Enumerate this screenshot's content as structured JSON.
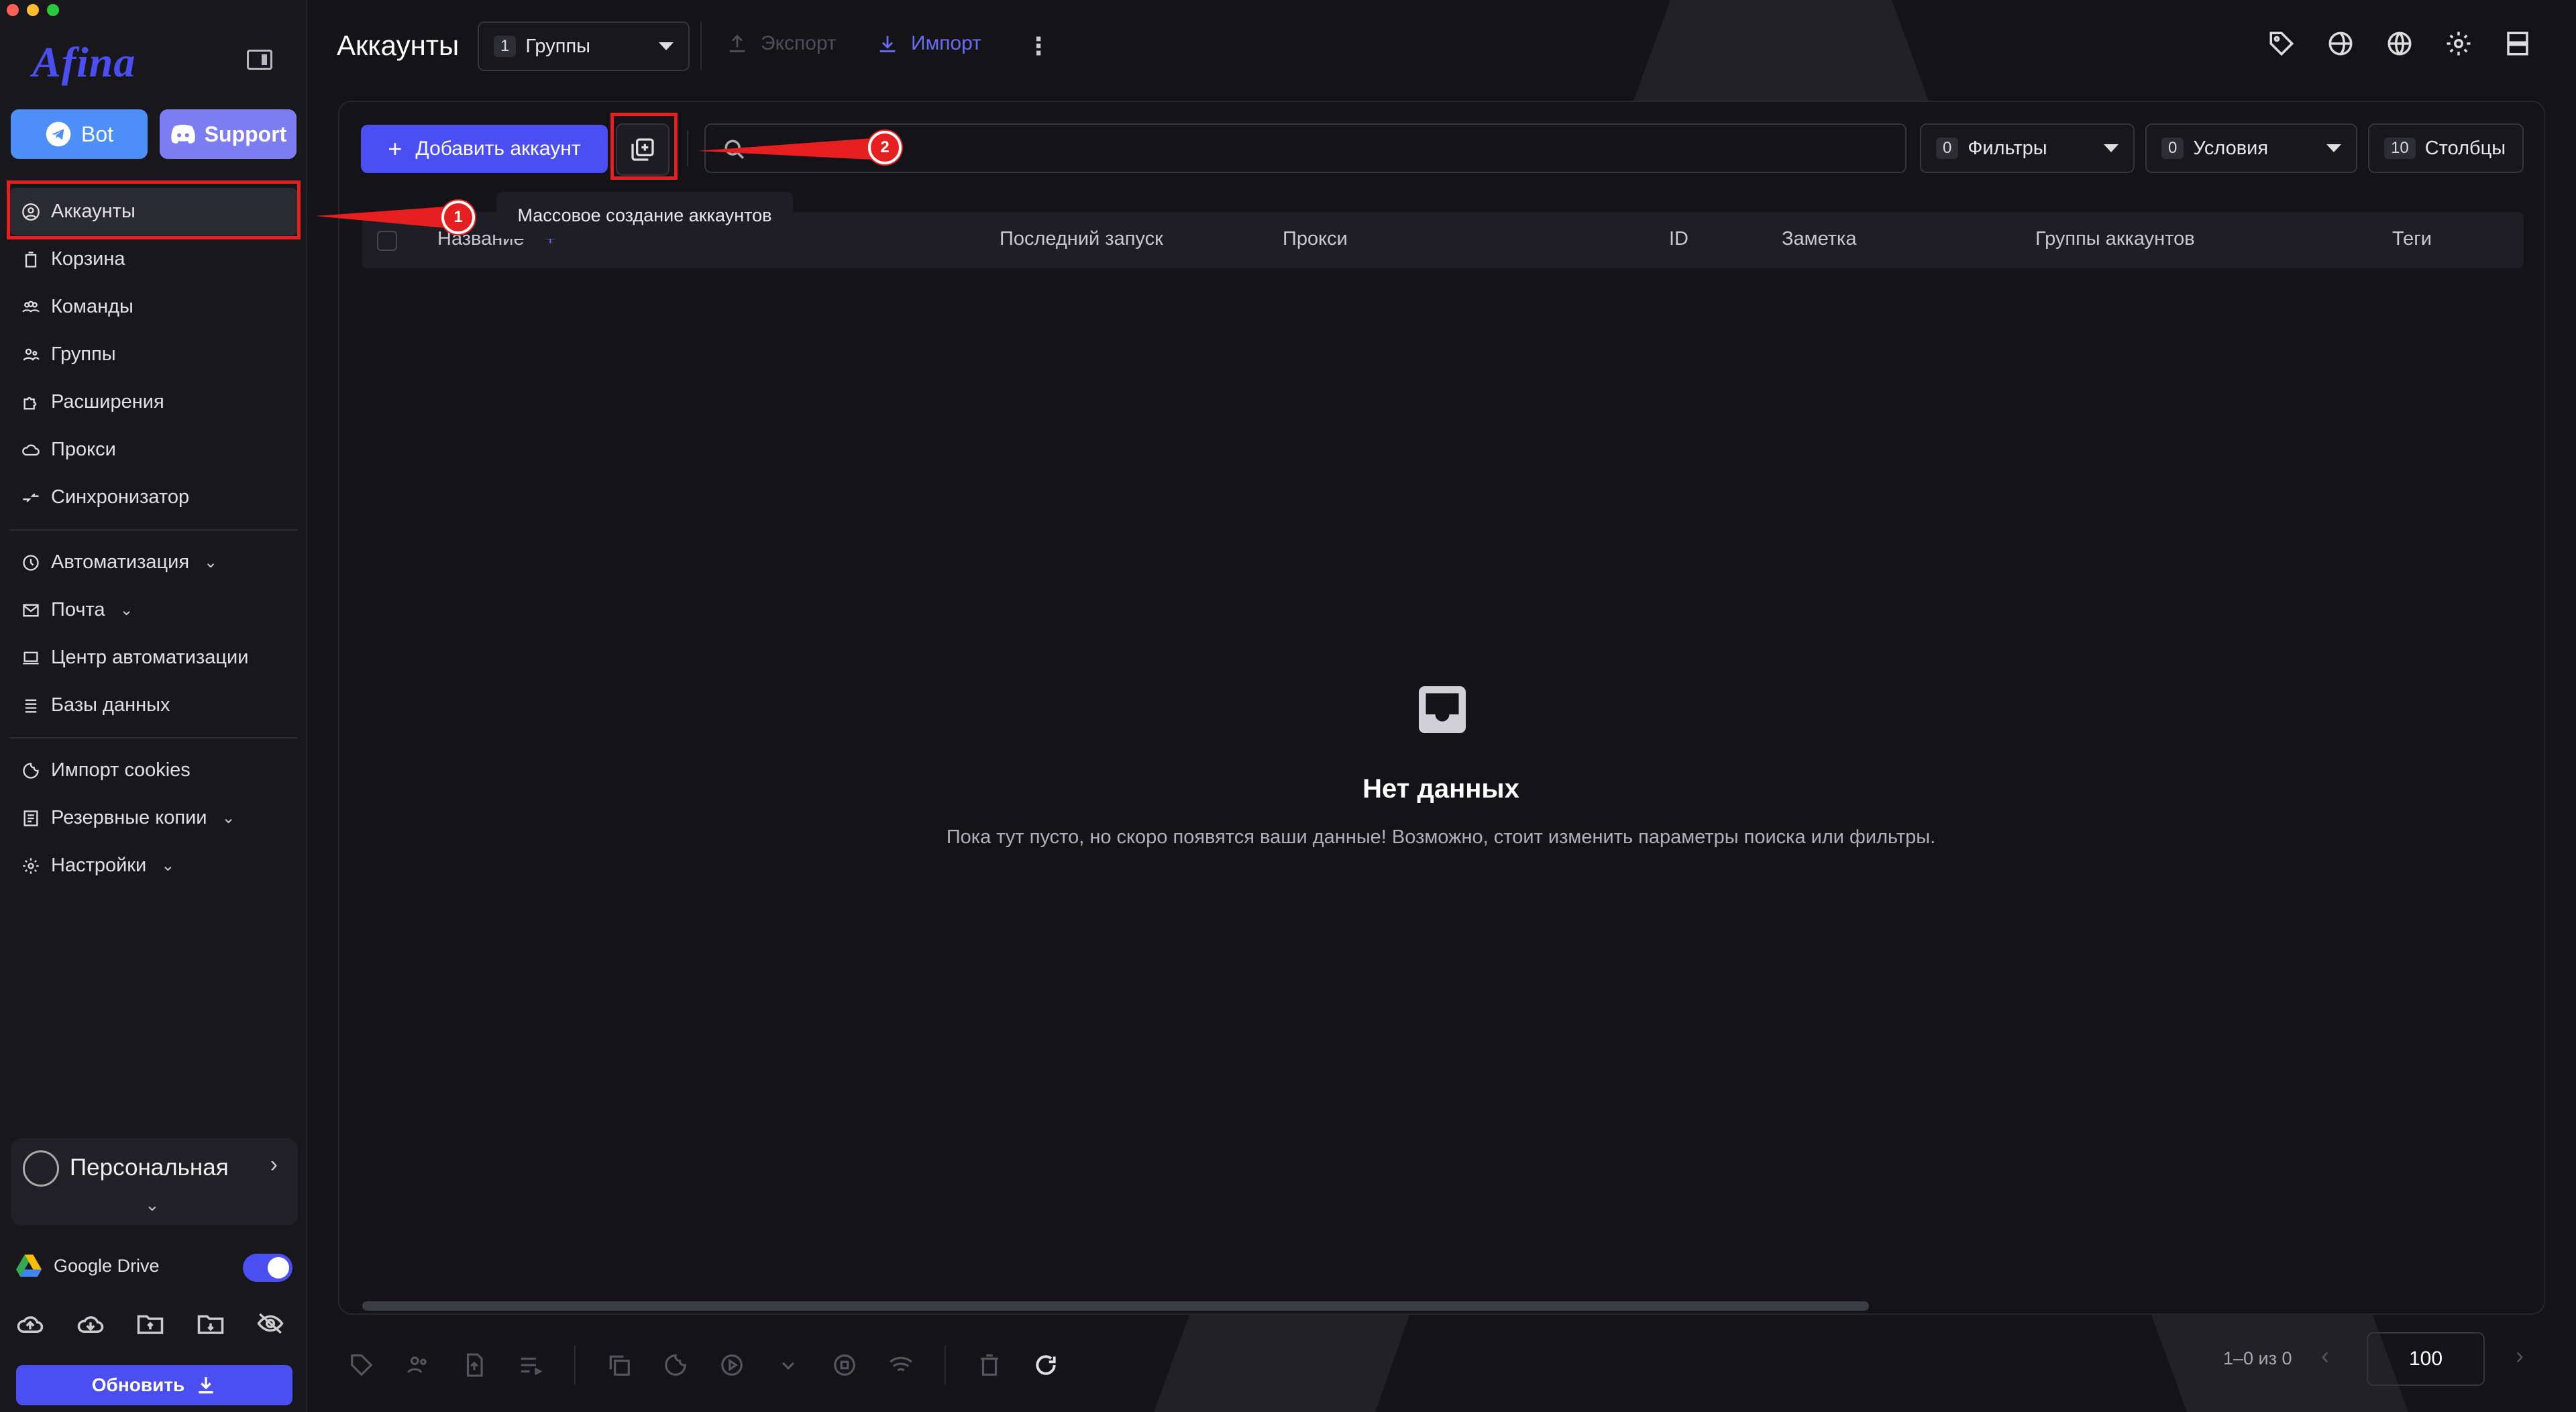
{
  "app": {
    "logo_text": "Afina",
    "accent": "#4b4ef0"
  },
  "sidebar": {
    "bot_label": "Bot",
    "support_label": "Support",
    "items_main": [
      {
        "label": "Аккаунты",
        "icon": "user-circle-icon"
      },
      {
        "label": "Корзина",
        "icon": "trash-icon"
      },
      {
        "label": "Команды",
        "icon": "team-icon"
      },
      {
        "label": "Группы",
        "icon": "group-icon"
      },
      {
        "label": "Расширения",
        "icon": "puzzle-icon"
      },
      {
        "label": "Прокси",
        "icon": "cloud-icon"
      },
      {
        "label": "Синхронизатор",
        "icon": "sync-icon"
      }
    ],
    "items_auto": [
      {
        "label": "Автоматизация",
        "icon": "automation-icon",
        "expandable": true
      },
      {
        "label": "Почта",
        "icon": "mail-icon",
        "expandable": true
      },
      {
        "label": "Центр автоматизации",
        "icon": "laptop-icon",
        "expandable": false
      },
      {
        "label": "Базы данных",
        "icon": "database-icon",
        "expandable": false
      }
    ],
    "items_settings": [
      {
        "label": "Импорт cookies",
        "icon": "cookie-icon",
        "expandable": false
      },
      {
        "label": "Резервные копии",
        "icon": "backup-icon",
        "expandable": true
      },
      {
        "label": "Настройки",
        "icon": "gear-icon",
        "expandable": true
      }
    ],
    "workspace_name": "Персональная",
    "gdrive_label": "Google Drive",
    "gdrive_enabled": true,
    "update_label": "Обновить"
  },
  "header": {
    "title": "Аккаунты",
    "groups_count": "1",
    "groups_label": "Группы",
    "export_label": "Экспорт",
    "import_label": "Импорт"
  },
  "toolbar": {
    "add_account_label": "Добавить аккаунт",
    "mass_create_tooltip": "Массовое создание аккаунтов",
    "filters_count": "0",
    "filters_label": "Фильтры",
    "conditions_count": "0",
    "conditions_label": "Условия",
    "columns_count": "10",
    "columns_label": "Столбцы"
  },
  "table": {
    "columns": [
      "Название",
      "Последний запуск",
      "Прокси",
      "ID",
      "Заметка",
      "Группы аккаунтов",
      "Теги"
    ],
    "empty_title": "Нет данных",
    "empty_subtitle": "Пока тут пусто, но скоро появятся ваши данные! Возможно, стоит изменить параметры поиска или фильтры."
  },
  "pagination": {
    "range_text": "1–0 из 0",
    "page_size": "100"
  },
  "annotations": [
    {
      "number": "1"
    },
    {
      "number": "2"
    }
  ],
  "colors": {
    "annotation": "#e62020",
    "accent": "#4b4ef0",
    "bot": "#4d8ef8",
    "support": "#7c7df0"
  }
}
